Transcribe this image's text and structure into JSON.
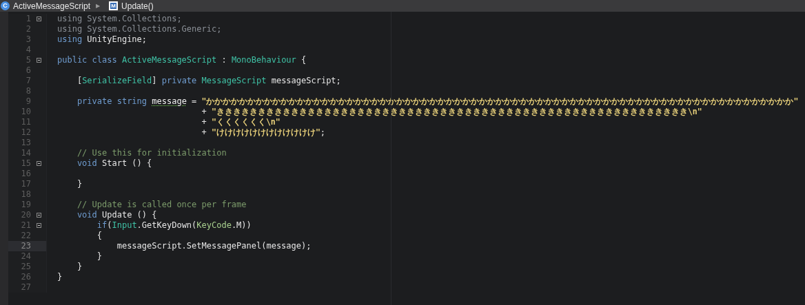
{
  "breadcrumb": {
    "separator": "▶",
    "items": [
      {
        "kind": "class",
        "icon_letter": "C",
        "label": "ActiveMessageScript"
      },
      {
        "kind": "method",
        "icon_letter": "M",
        "label": "Update()"
      }
    ]
  },
  "editor": {
    "lines": [
      {
        "number": "1",
        "foldable": true,
        "current": false,
        "tokens": [
          {
            "kind": "dimmed",
            "text": "using System.Collections;"
          }
        ]
      },
      {
        "number": "2",
        "foldable": false,
        "current": false,
        "tokens": [
          {
            "kind": "dimmed",
            "text": "using System.Collections.Generic;"
          }
        ]
      },
      {
        "number": "3",
        "foldable": false,
        "current": false,
        "tokens": [
          {
            "kind": "keyword",
            "text": "using"
          },
          {
            "kind": "plain",
            "text": " UnityEngine;"
          }
        ]
      },
      {
        "number": "4",
        "foldable": false,
        "current": false
      },
      {
        "number": "5",
        "foldable": true,
        "current": false,
        "tokens": [
          {
            "kind": "keyword",
            "text": "public class "
          },
          {
            "kind": "type",
            "text": "ActiveMessageScript"
          },
          {
            "kind": "plain",
            "text": " : "
          },
          {
            "kind": "type",
            "text": "MonoBehaviour"
          },
          {
            "kind": "plain",
            "text": " {"
          }
        ]
      },
      {
        "number": "6",
        "foldable": false,
        "current": false
      },
      {
        "number": "7",
        "foldable": false,
        "current": false,
        "tokens": [
          {
            "kind": "plain",
            "text": "    ["
          },
          {
            "kind": "type",
            "text": "SerializeField"
          },
          {
            "kind": "plain",
            "text": "] "
          },
          {
            "kind": "keyword",
            "text": "private "
          },
          {
            "kind": "type",
            "text": "MessageScript"
          },
          {
            "kind": "plain",
            "text": " messageScript;"
          }
        ]
      },
      {
        "number": "8",
        "foldable": false,
        "current": false
      },
      {
        "number": "9",
        "foldable": false,
        "current": false,
        "tokens": [
          {
            "kind": "keyword",
            "text": "    private string "
          },
          {
            "kind": "warning",
            "text": "message"
          },
          {
            "kind": "plain",
            "text": " = "
          },
          {
            "kind": "string",
            "text": "\"かかかかかかかかかかかかかかかかかかかかかかかかかかかかかかかかかかかかかかかかかかかかかかかかかかかかかかかかかかかかかかかかかかかかかかか\""
          }
        ]
      },
      {
        "number": "10",
        "foldable": false,
        "current": false,
        "tokens": [
          {
            "kind": "plain",
            "text": "                             + "
          },
          {
            "kind": "string",
            "text": "\"ききききききききききききききききききききききききききききききききききききききききききききききききききききききききき\\n\""
          }
        ]
      },
      {
        "number": "11",
        "foldable": false,
        "current": false,
        "tokens": [
          {
            "kind": "plain",
            "text": "                             + "
          },
          {
            "kind": "string",
            "text": "\"くくくくくく\\n\""
          }
        ]
      },
      {
        "number": "12",
        "foldable": false,
        "current": false,
        "tokens": [
          {
            "kind": "plain",
            "text": "                             + "
          },
          {
            "kind": "string",
            "text": "\"けけけけけけけけけけけけ\""
          },
          {
            "kind": "plain",
            "text": ";"
          }
        ]
      },
      {
        "number": "13",
        "foldable": false,
        "current": false
      },
      {
        "number": "14",
        "foldable": false,
        "current": false,
        "tokens": [
          {
            "kind": "comment",
            "text": "    // Use this for initialization"
          }
        ]
      },
      {
        "number": "15",
        "foldable": true,
        "current": false,
        "tokens": [
          {
            "kind": "keyword",
            "text": "    void"
          },
          {
            "kind": "plain",
            "text": " Start () {"
          }
        ]
      },
      {
        "number": "16",
        "foldable": false,
        "current": false
      },
      {
        "number": "17",
        "foldable": false,
        "current": false,
        "tokens": [
          {
            "kind": "plain",
            "text": "    }"
          }
        ]
      },
      {
        "number": "18",
        "foldable": false,
        "current": false
      },
      {
        "number": "19",
        "foldable": false,
        "current": false,
        "tokens": [
          {
            "kind": "comment",
            "text": "    // Update is called once per frame"
          }
        ]
      },
      {
        "number": "20",
        "foldable": true,
        "current": false,
        "tokens": [
          {
            "kind": "keyword",
            "text": "    void"
          },
          {
            "kind": "plain",
            "text": " Update () {"
          }
        ]
      },
      {
        "number": "21",
        "foldable": true,
        "current": false,
        "tokens": [
          {
            "kind": "keyword",
            "text": "        if"
          },
          {
            "kind": "plain",
            "text": "("
          },
          {
            "kind": "type",
            "text": "Input"
          },
          {
            "kind": "plain",
            "text": ".GetKeyDown("
          },
          {
            "kind": "enum",
            "text": "KeyCode"
          },
          {
            "kind": "plain",
            "text": ".M))"
          }
        ]
      },
      {
        "number": "22",
        "foldable": false,
        "current": false,
        "tokens": [
          {
            "kind": "plain",
            "text": "        {"
          }
        ]
      },
      {
        "number": "23",
        "foldable": false,
        "current": true,
        "tokens": [
          {
            "kind": "plain",
            "text": "            messageScript.SetMessagePanel(message);"
          }
        ]
      },
      {
        "number": "24",
        "foldable": false,
        "current": false,
        "tokens": [
          {
            "kind": "plain",
            "text": "        }"
          }
        ]
      },
      {
        "number": "25",
        "foldable": false,
        "current": false,
        "tokens": [
          {
            "kind": "plain",
            "text": "    }"
          }
        ]
      },
      {
        "number": "26",
        "foldable": false,
        "current": false,
        "tokens": [
          {
            "kind": "plain",
            "text": "}"
          }
        ]
      },
      {
        "number": "27",
        "foldable": false,
        "current": false
      }
    ]
  }
}
